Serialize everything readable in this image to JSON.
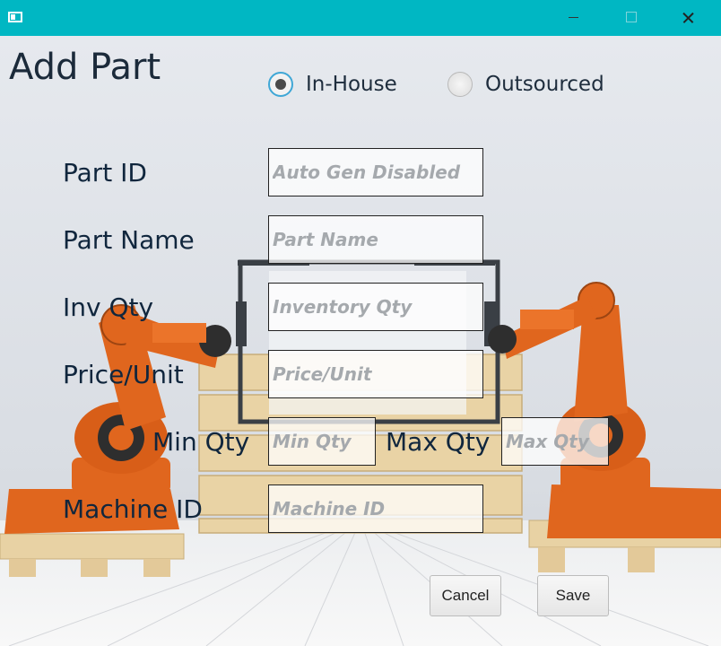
{
  "window": {
    "title": "",
    "icon": "window-icon"
  },
  "form": {
    "title": "Add Part",
    "source_options": [
      {
        "label": "In-House",
        "selected": true
      },
      {
        "label": "Outsourced",
        "selected": false
      }
    ],
    "labels": {
      "part_id": "Part ID",
      "part_name": "Part Name",
      "inv_qty": "Inv Qty",
      "price_unit": "Price/Unit",
      "min_qty": "Min Qty",
      "max_qty": "Max Qty",
      "machine_id": "Machine ID"
    },
    "placeholders": {
      "part_id": "Auto Gen Disabled",
      "part_name": "Part Name",
      "inv_qty": "Inventory Qty",
      "price_unit": "Price/Unit",
      "min_qty": "Min Qty",
      "max_qty": "Max Qty",
      "machine_id": "Machine ID"
    },
    "values": {
      "part_id": "",
      "part_name": "",
      "inv_qty": "",
      "price_unit": "",
      "min_qty": "",
      "max_qty": "",
      "machine_id": ""
    }
  },
  "buttons": {
    "cancel": "Cancel",
    "save": "Save"
  },
  "colors": {
    "titlebar": "#00b7c3",
    "robot": "#e0661e",
    "pallet": "#e8d2a4"
  }
}
